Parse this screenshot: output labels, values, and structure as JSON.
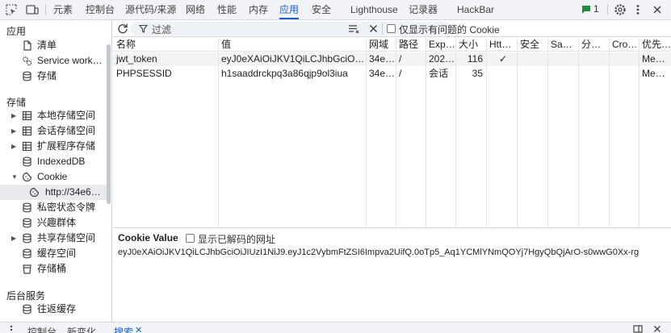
{
  "toolbar": {
    "tabs": [
      {
        "label": "元素"
      },
      {
        "label": "控制台"
      },
      {
        "label": "源代码/来源"
      },
      {
        "label": "网络"
      },
      {
        "label": "性能"
      },
      {
        "label": "内存"
      },
      {
        "label": "应用"
      },
      {
        "label": "安全"
      },
      {
        "label": "Lighthouse"
      },
      {
        "label": "记录器"
      },
      {
        "label": "HackBar"
      }
    ],
    "active_tab": "应用",
    "issues_count": "1",
    "accent": "#1a5fc9",
    "issues_color": "#1e8e3e"
  },
  "sidebar": {
    "app_header": "应用",
    "app_items": [
      {
        "label": "清单",
        "icon": "file-icon"
      },
      {
        "label": "Service work…",
        "icon": "gears-icon"
      },
      {
        "label": "存储",
        "icon": "database-icon"
      }
    ],
    "storage_header": "存储",
    "storage_items": [
      {
        "label": "本地存储空间",
        "icon": "table-icon"
      },
      {
        "label": "会话存储空间",
        "icon": "table-icon"
      },
      {
        "label": "扩展程序存储",
        "icon": "table-icon"
      },
      {
        "label": "IndexedDB",
        "icon": "database-icon"
      },
      {
        "label": "Cookie",
        "icon": "cookie-icon"
      },
      {
        "label": "http://34e6…",
        "icon": "cookie-icon"
      },
      {
        "label": "私密状态令牌",
        "icon": "database-icon"
      },
      {
        "label": "兴趣群体",
        "icon": "database-icon"
      },
      {
        "label": "共享存储空间",
        "icon": "database-icon"
      },
      {
        "label": "缓存空间",
        "icon": "database-icon"
      },
      {
        "label": "存储桶",
        "icon": "bucket-icon"
      }
    ],
    "backend_header": "后台服务",
    "backend_items": [
      {
        "label": "往返缓存",
        "icon": "database-icon"
      }
    ]
  },
  "cookies": {
    "filter_placeholder": "过滤",
    "only_issues_label": "仅显示有问题的 Cookie",
    "columns": [
      "名称",
      "值",
      "网域",
      "路径",
      "Expi…",
      "大小",
      "Htt…",
      "安全",
      "Sam…",
      "分区…",
      "Cro…",
      "优先…"
    ],
    "rows": [
      [
        "jwt_token",
        "eyJ0eXAiOiJKV1QiLCJhbGciOiJIU…",
        "34e…",
        "/",
        "202…",
        "116",
        "✓",
        "",
        "",
        "",
        "",
        "Me…"
      ],
      [
        "PHPSESSID",
        "h1saaddrckpq3a86qjp9ol3iua",
        "34e…",
        "/",
        "会话",
        "35",
        "",
        "",
        "",
        "",
        "",
        "Me…"
      ]
    ]
  },
  "cookie_value": {
    "title": "Cookie Value",
    "decode_label": "显示已解码的网址",
    "value": "eyJ0eXAiOiJKV1QiLCJhbGciOiJIUzI1NiJ9.eyJ1c2VybmFtZSI6Impva2UifQ.0oTp5_Aq1YCMlYNmQOYj7HgyQbQjArO-s0wwG0Xx-rg"
  },
  "drawer": {
    "tabs": [
      {
        "label": "控制台"
      },
      {
        "label": "新变化"
      },
      {
        "label": "搜索"
      }
    ]
  }
}
